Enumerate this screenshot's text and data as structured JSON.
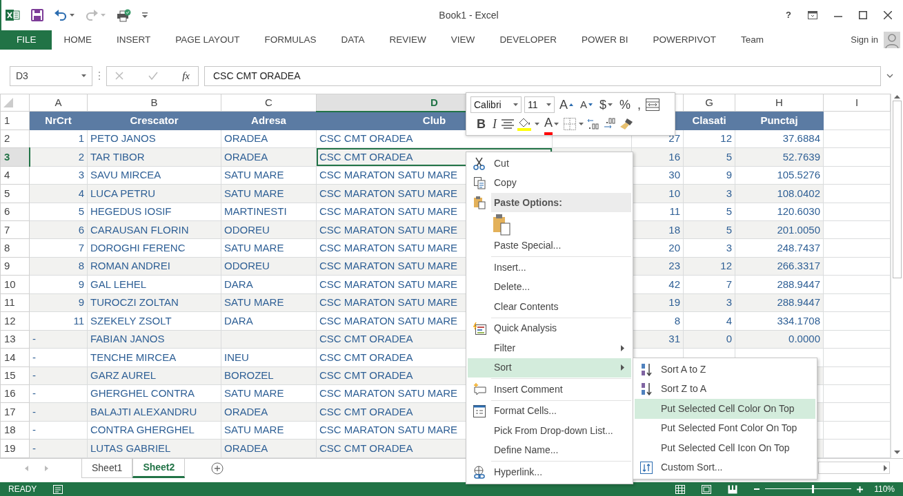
{
  "window": {
    "title": "Book1 - Excel",
    "help": "?"
  },
  "ribbon_tabs": [
    {
      "label": "FILE",
      "selected": true
    },
    {
      "label": "HOME",
      "selected": false
    },
    {
      "label": "INSERT",
      "selected": false
    },
    {
      "label": "PAGE LAYOUT",
      "selected": false
    },
    {
      "label": "FORMULAS",
      "selected": false
    },
    {
      "label": "DATA",
      "selected": false
    },
    {
      "label": "REVIEW",
      "selected": false
    },
    {
      "label": "VIEW",
      "selected": false
    },
    {
      "label": "DEVELOPER",
      "selected": false
    },
    {
      "label": "POWER BI",
      "selected": false
    },
    {
      "label": "POWERPIVOT",
      "selected": false
    },
    {
      "label": "Team",
      "selected": false
    }
  ],
  "account": {
    "sign_in": "Sign in"
  },
  "formula_bar": {
    "name_box": "D3",
    "fx": "fx",
    "value": "CSC CMT ORADEA"
  },
  "columns": [
    {
      "letter": "A",
      "selected": false
    },
    {
      "letter": "B",
      "selected": false
    },
    {
      "letter": "C",
      "selected": false
    },
    {
      "letter": "D",
      "selected": true
    },
    {
      "letter": "G",
      "selected": false
    },
    {
      "letter": "H",
      "selected": false
    },
    {
      "letter": "I",
      "selected": false
    }
  ],
  "rows": [
    {
      "number": "1",
      "kind": "header",
      "selected": false,
      "cells": {
        "A": "NrCrt",
        "B": "Crescator",
        "C": "Adresa",
        "D": "Club",
        "G": "Clasati",
        "H": "Punctaj"
      }
    },
    {
      "number": "2",
      "kind": "data",
      "selected": false,
      "cells": {
        "A": "1",
        "B": "PETO JANOS",
        "C": "ORADEA",
        "D": "CSC CMT ORADEA",
        "F": "27",
        "G": "12",
        "H": "37.6884"
      }
    },
    {
      "number": "3",
      "kind": "data",
      "selected": true,
      "cells": {
        "A": "2",
        "B": "TAR TIBOR",
        "C": "ORADEA",
        "D": "CSC CMT ORADEA",
        "F": "16",
        "G": "5",
        "H": "52.7639"
      }
    },
    {
      "number": "4",
      "kind": "data",
      "selected": false,
      "cells": {
        "A": "3",
        "B": "SAVU MIRCEA",
        "C": "SATU MARE",
        "D": "CSC MARATON SATU MARE",
        "F": "30",
        "G": "9",
        "H": "105.5276"
      }
    },
    {
      "number": "5",
      "kind": "data",
      "selected": false,
      "cells": {
        "A": "4",
        "B": "LUCA PETRU",
        "C": "SATU MARE",
        "D": "CSC MARATON SATU MARE",
        "F": "10",
        "G": "3",
        "H": "108.0402"
      }
    },
    {
      "number": "6",
      "kind": "data",
      "selected": false,
      "cells": {
        "A": "5",
        "B": "HEGEDUS IOSIF",
        "C": "MARTINESTI",
        "D": "CSC MARATON SATU MARE",
        "F": "11",
        "G": "5",
        "H": "120.6030"
      }
    },
    {
      "number": "7",
      "kind": "data",
      "selected": false,
      "cells": {
        "A": "6",
        "B": "CARAUSAN FLORIN",
        "C": "ODOREU",
        "D": "CSC MARATON SATU MARE",
        "F": "18",
        "G": "5",
        "H": "201.0050"
      }
    },
    {
      "number": "8",
      "kind": "data",
      "selected": false,
      "cells": {
        "A": "7",
        "B": "DOROGHI FERENC",
        "C": "SATU MARE",
        "D": "CSC MARATON SATU MARE",
        "F": "20",
        "G": "3",
        "H": "248.7437"
      }
    },
    {
      "number": "9",
      "kind": "data",
      "selected": false,
      "cells": {
        "A": "8",
        "B": "ROMAN ANDREI",
        "C": "ODOREU",
        "D": "CSC MARATON SATU MARE",
        "F": "23",
        "G": "12",
        "H": "266.3317"
      }
    },
    {
      "number": "10",
      "kind": "data",
      "selected": false,
      "cells": {
        "A": "9",
        "B": "GAL LEHEL",
        "C": "DARA",
        "D": "CSC MARATON SATU MARE",
        "F": "42",
        "G": "7",
        "H": "288.9447"
      }
    },
    {
      "number": "11",
      "kind": "data",
      "selected": false,
      "cells": {
        "A": "9",
        "B": "TUROCZI ZOLTAN",
        "C": "SATU MARE",
        "D": "CSC MARATON SATU MARE",
        "F": "19",
        "G": "3",
        "H": "288.9447"
      }
    },
    {
      "number": "12",
      "kind": "data",
      "selected": false,
      "cells": {
        "A": "11",
        "B": "SZEKELY ZSOLT",
        "C": "DARA",
        "D": "CSC MARATON SATU MARE",
        "F": "8",
        "G": "4",
        "H": "334.1708"
      }
    },
    {
      "number": "13",
      "kind": "data",
      "selected": false,
      "cells": {
        "A": "-",
        "B": "FABIAN JANOS",
        "D": "CSC CMT ORADEA",
        "F": "31",
        "G": "0",
        "H": "0.0000"
      }
    },
    {
      "number": "14",
      "kind": "data",
      "selected": false,
      "cells": {
        "A": "-",
        "B": "TENCHE MIRCEA",
        "C": "INEU",
        "D": "CSC CMT ORADEA"
      }
    },
    {
      "number": "15",
      "kind": "data",
      "selected": false,
      "cells": {
        "A": "-",
        "B": "GARZ AUREL",
        "C": "BOROZEL",
        "D": "CSC CMT ORADEA"
      }
    },
    {
      "number": "16",
      "kind": "data",
      "selected": false,
      "cells": {
        "A": "-",
        "B": "GHERGHEL CONTRA",
        "C": "SATU MARE",
        "D": "CSC MARATON SATU MARE"
      }
    },
    {
      "number": "17",
      "kind": "data",
      "selected": false,
      "cells": {
        "A": "-",
        "B": "BALAJTI ALEXANDRU",
        "C": "ORADEA",
        "D": "CSC CMT ORADEA"
      }
    },
    {
      "number": "18",
      "kind": "data",
      "selected": false,
      "cells": {
        "A": "-",
        "B": "CONTRA GHERGHEL",
        "C": "SATU MARE",
        "D": "CSC MARATON SATU MARE"
      }
    },
    {
      "number": "19",
      "kind": "data",
      "selected": false,
      "cells": {
        "A": "-",
        "B": "LUTAS GABRIEL",
        "C": "ORADEA",
        "D": "CSC CMT ORADEA"
      }
    }
  ],
  "mini_toolbar": {
    "font": "Calibri",
    "size": "11",
    "row_1": [
      {
        "kind": "grow",
        "text": "A"
      },
      {
        "kind": "shrink",
        "text": "A"
      },
      {
        "kind": "currency",
        "text": "$"
      },
      {
        "kind": "percent",
        "text": "%"
      },
      {
        "kind": "comma",
        "text": ","
      },
      {
        "kind": "wrap"
      }
    ],
    "row_2": [
      {
        "kind": "bold",
        "text": "B"
      },
      {
        "kind": "italic",
        "text": "I"
      },
      {
        "kind": "align"
      },
      {
        "kind": "fill"
      },
      {
        "kind": "fontcolor",
        "text": "A"
      },
      {
        "kind": "borders"
      },
      {
        "kind": "incdecimal"
      },
      {
        "kind": "decdecimal"
      },
      {
        "kind": "painter"
      }
    ]
  },
  "context_menu": {
    "items": [
      {
        "kind": "cut",
        "label": "Cut",
        "selected": false,
        "submenu": false
      },
      {
        "kind": "copy",
        "label": "Copy",
        "selected": false,
        "submenu": false
      },
      {
        "kind": "header",
        "label": "Paste Options:"
      },
      {
        "kind": "paste"
      },
      {
        "kind": "plain",
        "label": "Paste Special...",
        "selected": false,
        "submenu": false
      },
      {
        "kind": "separator"
      },
      {
        "kind": "plain",
        "label": "Insert...",
        "selected": false,
        "submenu": false
      },
      {
        "kind": "plain",
        "label": "Delete...",
        "selected": false,
        "submenu": false
      },
      {
        "kind": "plain",
        "label": "Clear Contents",
        "selected": false,
        "submenu": false
      },
      {
        "kind": "separator"
      },
      {
        "kind": "analysis",
        "label": "Quick Analysis",
        "selected": false,
        "submenu": false
      },
      {
        "kind": "plain",
        "label": "Filter",
        "selected": false,
        "submenu": true
      },
      {
        "kind": "plain",
        "label": "Sort",
        "selected": true,
        "submenu": true
      },
      {
        "kind": "separator"
      },
      {
        "kind": "comment",
        "label": "Insert Comment",
        "selected": false,
        "submenu": false
      },
      {
        "kind": "separator"
      },
      {
        "kind": "format",
        "label": "Format Cells...",
        "selected": false,
        "submenu": false
      },
      {
        "kind": "plain",
        "label": "Pick From Drop-down List...",
        "selected": false,
        "submenu": false
      },
      {
        "kind": "plain",
        "label": "Define Name...",
        "selected": false,
        "submenu": false
      },
      {
        "kind": "separator"
      },
      {
        "kind": "link",
        "label": "Hyperlink...",
        "selected": false,
        "submenu": false
      }
    ]
  },
  "sort_submenu": {
    "items": [
      {
        "kind": "sortaz",
        "label": "Sort A to Z",
        "selected": false
      },
      {
        "kind": "sortza",
        "label": "Sort Z to A",
        "selected": false
      },
      {
        "kind": "plain",
        "label": "Put Selected Cell Color On Top",
        "selected": true
      },
      {
        "kind": "plain",
        "label": "Put Selected Font Color On Top",
        "selected": false
      },
      {
        "kind": "plain",
        "label": "Put Selected Cell Icon On Top",
        "selected": false
      },
      {
        "kind": "customsort",
        "label": "Custom Sort...",
        "selected": false
      }
    ]
  },
  "sheets": [
    {
      "label": "Sheet1",
      "selected": false
    },
    {
      "label": "Sheet2",
      "selected": true
    }
  ],
  "status_bar": {
    "mode": "READY",
    "zoom": {
      "level": 0.55,
      "reading": "110%"
    }
  }
}
